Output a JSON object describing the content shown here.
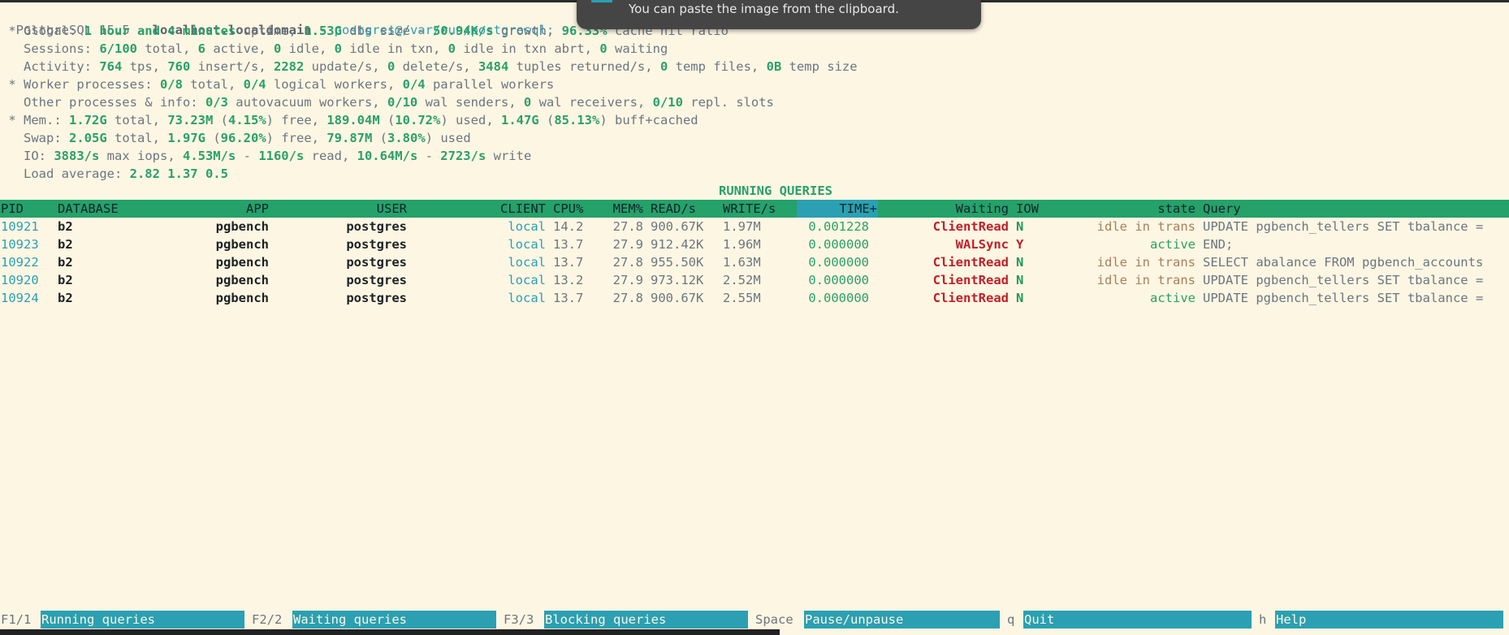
{
  "header": {
    "line1": {
      "app": "PostgreSQL 15.5",
      "sep1": " - ",
      "host": "localhost.localdomain",
      "sep2": " - ",
      "conn": "postgres@/var/run/postgresql:"
    },
    "global": {
      "prefix": " * Global: ",
      "uptime": "1 hour and 4 minutes",
      "t1": " uptime, ",
      "dbsize": "1.53G",
      "t2": " dbs size - ",
      "growth": "50.94K/s",
      "t3": " growth, ",
      "cache": "96.33%",
      "t4": " cache hit ratio"
    },
    "sessions": {
      "prefix": "   Sessions: ",
      "total": "6/100",
      "t1": " total, ",
      "active": "6",
      "t2": " active, ",
      "idle": "0",
      "t3": " idle, ",
      "idle_txn": "0",
      "t4": " idle in txn, ",
      "idle_abrt": "0",
      "t5": " idle in txn abrt, ",
      "waiting": "0",
      "t6": " waiting"
    },
    "activity": {
      "prefix": "   Activity: ",
      "tps": "764",
      "t1": " tps, ",
      "insert": "760",
      "t2": " insert/s, ",
      "update": "2282",
      "t3": " update/s, ",
      "delete": "0",
      "t4": " delete/s, ",
      "tuples": "3484",
      "t5": " tuples returned/s, ",
      "temp_files": "0",
      "t6": " temp files, ",
      "temp_size": "0B",
      "t7": " temp size"
    },
    "workers": {
      "prefix": " * Worker processes: ",
      "total": "0/8",
      "t1": " total, ",
      "logical": "0/4",
      "t2": " logical workers, ",
      "parallel": "0/4",
      "t3": " parallel workers"
    },
    "other": {
      "prefix": "   Other processes & info: ",
      "autovac": "0/3",
      "t1": " autovacuum workers, ",
      "walsend": "0/10",
      "t2": " wal senders, ",
      "walrecv": "0",
      "t3": " wal receivers, ",
      "repl": "0/10",
      "t4": " repl. slots"
    },
    "mem": {
      "prefix": " * Mem.: ",
      "total": "1.72G",
      "t1": " total, ",
      "free": "73.23M",
      "t2": " (",
      "free_pct": "4.15%",
      "t3": ") free, ",
      "used": "189.04M",
      "t4": " (",
      "used_pct": "10.72%",
      "t5": ") used, ",
      "buff": "1.47G",
      "t6": " (",
      "buff_pct": "85.13%",
      "t7": ") buff+cached"
    },
    "swap": {
      "prefix": "   Swap: ",
      "total": "2.05G",
      "t1": " total, ",
      "free": "1.97G",
      "t2": " (",
      "free_pct": "96.20%",
      "t3": ") free, ",
      "used": "79.87M",
      "t4": " (",
      "used_pct": "3.80%",
      "t5": ") used"
    },
    "io": {
      "prefix": "   IO: ",
      "iops": "3883/s",
      "t1": " max iops, ",
      "read_bw": "4.53M/s",
      "t2": " - ",
      "read_ops": "1160/s",
      "t3": " read, ",
      "write_bw": "10.64M/s",
      "t4": " - ",
      "write_ops": "2723/s",
      "t5": " write"
    },
    "load": {
      "prefix": "   Load average: ",
      "values": "2.82 1.37 0.5"
    }
  },
  "section_title": "RUNNING QUERIES",
  "table": {
    "columns": [
      "PID",
      "DATABASE",
      "APP",
      "USER",
      "CLIENT",
      "CPU%",
      "MEM%",
      "READ/s",
      "WRITE/s",
      "TIME+",
      "Waiting",
      "IOW",
      "state",
      "Query"
    ],
    "sorted_column": "TIME+",
    "rows": [
      {
        "pid": "10921",
        "database": "b2",
        "app": "pgbench",
        "user": "postgres",
        "client": "local",
        "cpu": "14.2",
        "mem": "27.8",
        "read": "900.67K",
        "write": "1.97M",
        "time": "0.001228",
        "waiting": "ClientRead",
        "iow": "N",
        "state": "idle in trans",
        "query": "UPDATE pgbench_tellers SET tbalance ="
      },
      {
        "pid": "10923",
        "database": "b2",
        "app": "pgbench",
        "user": "postgres",
        "client": "local",
        "cpu": "13.7",
        "mem": "27.9",
        "read": "912.42K",
        "write": "1.96M",
        "time": "0.000000",
        "waiting": "WALSync",
        "iow": "Y",
        "state": "active",
        "query": "END;"
      },
      {
        "pid": "10922",
        "database": "b2",
        "app": "pgbench",
        "user": "postgres",
        "client": "local",
        "cpu": "13.7",
        "mem": "27.8",
        "read": "955.50K",
        "write": "1.63M",
        "time": "0.000000",
        "waiting": "ClientRead",
        "iow": "N",
        "state": "idle in trans",
        "query": "SELECT abalance FROM pgbench_accounts"
      },
      {
        "pid": "10920",
        "database": "b2",
        "app": "pgbench",
        "user": "postgres",
        "client": "local",
        "cpu": "13.2",
        "mem": "27.9",
        "read": "973.12K",
        "write": "2.52M",
        "time": "0.000000",
        "waiting": "ClientRead",
        "iow": "N",
        "state": "idle in trans",
        "query": "UPDATE pgbench_tellers SET tbalance ="
      },
      {
        "pid": "10924",
        "database": "b2",
        "app": "pgbench",
        "user": "postgres",
        "client": "local",
        "cpu": "13.7",
        "mem": "27.8",
        "read": "900.67K",
        "write": "2.55M",
        "time": "0.000000",
        "waiting": "ClientRead",
        "iow": "N",
        "state": "active",
        "query": "UPDATE pgbench_tellers SET tbalance ="
      }
    ]
  },
  "footer": [
    {
      "key": "F1/1",
      "label": "Running queries"
    },
    {
      "key": "F2/2",
      "label": "Waiting queries"
    },
    {
      "key": "F3/3",
      "label": "Blocking queries"
    },
    {
      "key": "Space",
      "label": "Pause/unpause"
    },
    {
      "key": "q",
      "label": "Quit"
    },
    {
      "key": "h",
      "label": "Help"
    }
  ],
  "toast": {
    "message": "You can paste the image from the clipboard."
  },
  "colors": {
    "background": "#fdf6e3",
    "header_row": "#25a16a",
    "highlight": "#2aa0b2",
    "value_green": "#2aa06a",
    "wait_red": "#c0202a"
  }
}
